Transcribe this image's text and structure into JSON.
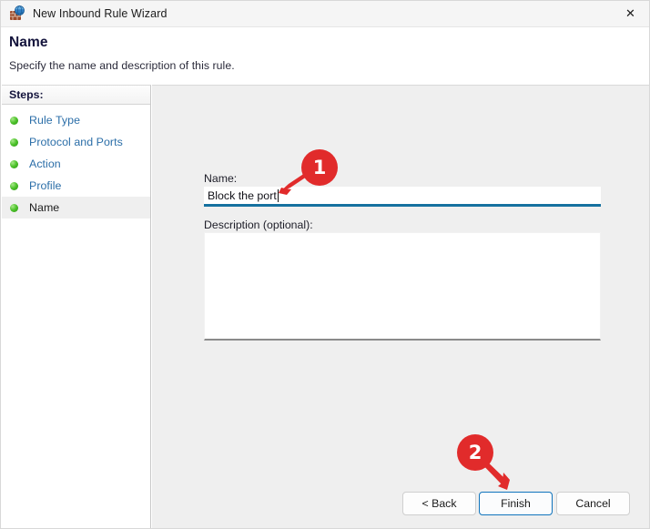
{
  "window": {
    "title": "New Inbound Rule Wizard",
    "icon": "firewall-shield-icon",
    "close_label": "✕"
  },
  "header": {
    "title": "Name",
    "subtitle": "Specify the name and description of this rule."
  },
  "sidebar": {
    "heading": "Steps:",
    "items": [
      {
        "label": "Rule Type",
        "state": "done"
      },
      {
        "label": "Protocol and Ports",
        "state": "done"
      },
      {
        "label": "Action",
        "state": "done"
      },
      {
        "label": "Profile",
        "state": "done"
      },
      {
        "label": "Name",
        "state": "current"
      }
    ]
  },
  "form": {
    "name_label": "Name:",
    "name_value": "Block the port",
    "name_placeholder": "",
    "description_label": "Description (optional):",
    "description_value": "",
    "description_placeholder": ""
  },
  "footer": {
    "back_label": "< Back",
    "finish_label": "Finish",
    "cancel_label": "Cancel"
  },
  "annotations": [
    {
      "number": "1",
      "target": "name-input"
    },
    {
      "number": "2",
      "target": "finish-button"
    }
  ],
  "colors": {
    "accent_blue": "#15719f",
    "focus_blue": "#1074bd",
    "link_blue": "#2b6ea8",
    "annotation_red": "#e12b2b",
    "step_done_green": "#4cc22a",
    "panel_gray": "#efefef"
  }
}
